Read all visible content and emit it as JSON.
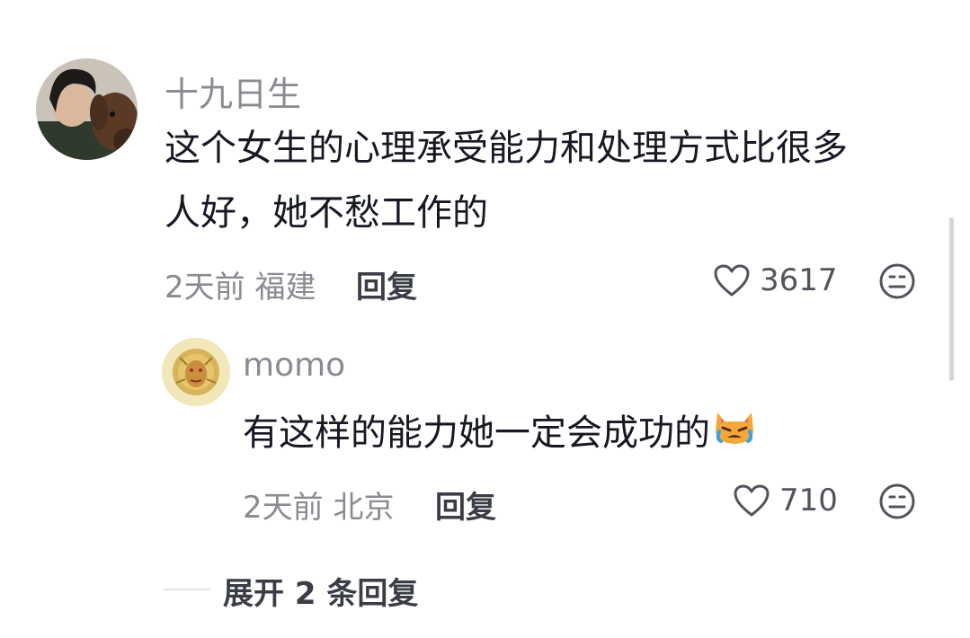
{
  "comment": {
    "username": "十九日生",
    "text_line1": "这个女生的心理承受能力和处理方式比很多",
    "text_line2": "人好，她不愁工作的",
    "time": "2天前",
    "location": "福建",
    "reply_label": "回复",
    "likes": "3617"
  },
  "reply": {
    "username": "momo",
    "text": "有这样的能力她一定会成功的",
    "emoji": "crying-cat-emoji",
    "time": "2天前",
    "location": "北京",
    "reply_label": "回复",
    "likes": "710"
  },
  "expand_label": "展开 2 条回复",
  "icons": {
    "like": "heart-outline-icon",
    "dislike": "frown-face-icon"
  }
}
